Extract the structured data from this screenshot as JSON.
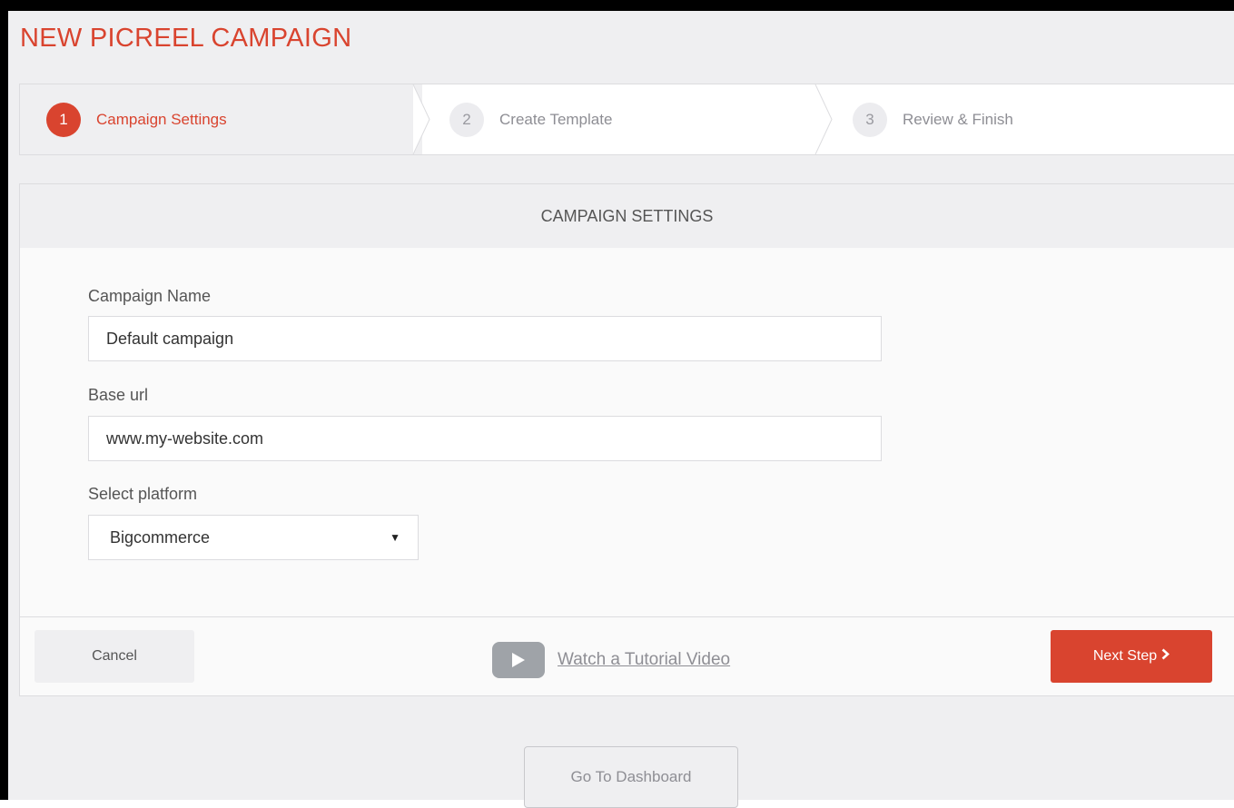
{
  "page": {
    "title": "NEW PICREEL CAMPAIGN"
  },
  "steps": [
    {
      "number": "1",
      "label": "Campaign Settings",
      "state": "active"
    },
    {
      "number": "2",
      "label": "Create Template",
      "state": "inactive"
    },
    {
      "number": "3",
      "label": "Review & Finish",
      "state": "inactive"
    }
  ],
  "card": {
    "header": "CAMPAIGN SETTINGS",
    "fields": {
      "campaign_name": {
        "label": "Campaign Name",
        "value": "Default campaign"
      },
      "base_url": {
        "label": "Base url",
        "value": "www.my-website.com"
      },
      "platform": {
        "label": "Select platform",
        "value": "Bigcommerce"
      }
    },
    "footer": {
      "cancel_label": "Cancel",
      "tutorial_label": "Watch a Tutorial Video",
      "next_label": "Next Step"
    }
  },
  "dashboard_label": "Go To Dashboard",
  "colors": {
    "accent": "#d9442f",
    "background": "#efeff1",
    "muted": "#8e8e94"
  },
  "icons": {
    "play": "play-icon",
    "chevron": "chevron-right-icon",
    "caret": "caret-down-icon"
  }
}
